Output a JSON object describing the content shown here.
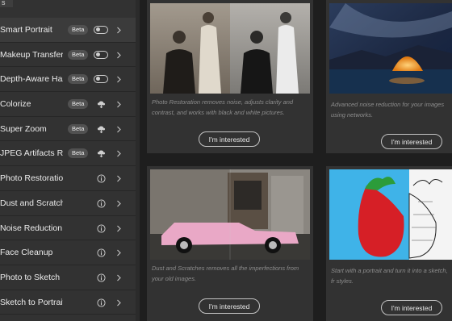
{
  "sidebar": {
    "header": "s",
    "items": [
      {
        "label": "Smart Portrait",
        "badge": "Beta",
        "control": "toggle",
        "active": true
      },
      {
        "label": "Makeup Transfer",
        "badge": "Beta",
        "control": "toggle"
      },
      {
        "label": "Depth-Aware Haze",
        "badge": "Beta",
        "control": "toggle"
      },
      {
        "label": "Colorize",
        "badge": "Beta",
        "control": "cloud-download-icon"
      },
      {
        "label": "Super Zoom",
        "badge": "Beta",
        "control": "cloud-download-icon"
      },
      {
        "label": "JPEG Artifacts Re...",
        "badge": "Beta",
        "control": "cloud-download-icon"
      },
      {
        "label": "Photo Restoration",
        "control": "info-icon"
      },
      {
        "label": "Dust and Scratches",
        "control": "info-icon"
      },
      {
        "label": "Noise Reduction",
        "control": "info-icon"
      },
      {
        "label": "Face Cleanup",
        "control": "info-icon"
      },
      {
        "label": "Photo to Sketch",
        "control": "info-icon"
      },
      {
        "label": "Sketch to Portrait",
        "control": "info-icon"
      }
    ]
  },
  "cards": {
    "photo_restoration": {
      "description": "Photo Restoration removes noise, adjusts clarity and contrast, and works with black and white pictures.",
      "button": "I'm interested"
    },
    "noise_reduction": {
      "description": "Advanced noise reduction for your images using networks.",
      "button": "I'm interested"
    },
    "dust_scratches": {
      "description": "Dust and Scratches removes all the imperfections from your old images.",
      "button": "I'm interested"
    },
    "photo_to_sketch": {
      "description": "Start with a portrait and turn it into a sketch, fr styles.",
      "button": "I'm interested"
    }
  }
}
